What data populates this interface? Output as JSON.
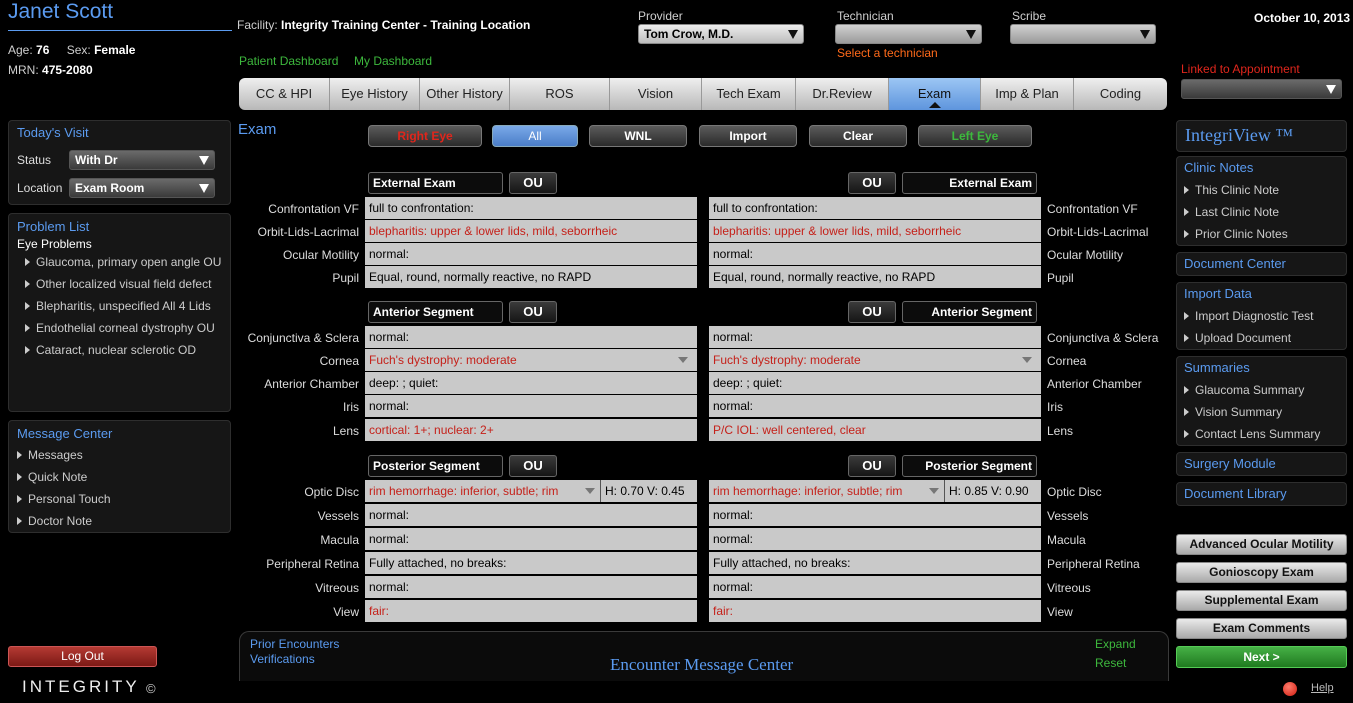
{
  "patient": {
    "name": "Janet Scott",
    "age_label": "Age:",
    "age": "76",
    "sex_label": "Sex:",
    "sex": "Female",
    "mrn_label": "MRN:",
    "mrn": "475-2080"
  },
  "header": {
    "facility_label": "Facility:",
    "facility": "Integrity Training Center - Training Location",
    "patient_dashboard": "Patient Dashboard",
    "my_dashboard": "My Dashboard",
    "provider_label": "Provider",
    "provider": "Tom Crow, M.D.",
    "technician_label": "Technician",
    "technician": "",
    "technician_hint": "Select a technician",
    "scribe_label": "Scribe",
    "scribe": "",
    "date": "October 10, 2013",
    "linked_label": "Linked to Appointment",
    "linked": ""
  },
  "tabs": [
    "CC & HPI",
    "Eye History",
    "Other History",
    "ROS",
    "Vision",
    "Tech Exam",
    "Dr.Review",
    "Exam",
    "Imp & Plan",
    "Coding"
  ],
  "todays_visit": {
    "title": "Today's Visit",
    "status_label": "Status",
    "status": "With Dr",
    "location_label": "Location",
    "location": "Exam Room"
  },
  "problem_list": {
    "title": "Problem List",
    "subtitle": "Eye Problems",
    "items": [
      "Glaucoma, primary open angle OU",
      "Other localized visual field defect",
      "Blepharitis, unspecified All 4 Lids",
      "Endothelial corneal dystrophy OU",
      "Cataract, nuclear sclerotic OD"
    ]
  },
  "message_center": {
    "title": "Message Center",
    "items": [
      "Messages",
      "Quick Note",
      "Personal Touch",
      "Doctor Note"
    ]
  },
  "logout": "Log Out",
  "logo": "INTEGRITY",
  "exam": {
    "title": "Exam",
    "buttons": {
      "right_eye": "Right Eye",
      "all": "All",
      "wnl": "WNL",
      "import": "Import",
      "clear": "Clear",
      "left_eye": "Left Eye"
    },
    "ou": "OU",
    "sections": [
      {
        "name": "External Exam",
        "rows": [
          {
            "label": "Confrontation VF",
            "od": "full to confrontation:",
            "os": "full to confrontation:",
            "red": false
          },
          {
            "label": "Orbit-Lids-Lacrimal",
            "od": "blepharitis: upper & lower lids, mild, seborrheic",
            "os": "blepharitis: upper & lower lids, mild, seborrheic",
            "red": true
          },
          {
            "label": "Ocular Motility",
            "od": "normal:",
            "os": "normal:",
            "red": false
          },
          {
            "label": "Pupil",
            "od": "Equal, round, normally reactive, no RAPD",
            "os": "Equal, round, normally reactive, no RAPD",
            "red": false
          }
        ]
      },
      {
        "name": "Anterior Segment",
        "rows": [
          {
            "label": "Conjunctiva & Sclera",
            "od": "normal:",
            "os": "normal:",
            "red": false
          },
          {
            "label": "Cornea",
            "od": "Fuch's dystrophy: moderate",
            "os": "Fuch's dystrophy: moderate",
            "red": true
          },
          {
            "label": "Anterior Chamber",
            "od": "deep: ; quiet:",
            "os": "deep: ; quiet:",
            "red": false
          },
          {
            "label": "Iris",
            "od": "normal:",
            "os": "normal:",
            "red": false
          },
          {
            "label": "Lens",
            "od": "cortical: 1+; nuclear: 2+",
            "os": "P/C IOL: well centered, clear",
            "red": true
          }
        ]
      },
      {
        "name": "Posterior Segment",
        "rows": [
          {
            "label": "Optic Disc",
            "od": "rim hemorrhage: inferior, subtle; rim",
            "os": "rim hemorrhage: inferior, subtle; rim",
            "red": true,
            "od_hv": "H: 0.70 V: 0.45",
            "os_hv": "H: 0.85 V: 0.90"
          },
          {
            "label": "Vessels",
            "od": "normal:",
            "os": "normal:",
            "red": false
          },
          {
            "label": "Macula",
            "od": "normal:",
            "os": "normal:",
            "red": false
          },
          {
            "label": "Peripheral Retina",
            "od": "Fully attached, no breaks:",
            "os": "Fully attached, no breaks:",
            "red": false
          },
          {
            "label": "Vitreous",
            "od": "normal:",
            "os": "normal:",
            "red": false
          },
          {
            "label": "View",
            "od": "fair:",
            "os": "fair:",
            "red": true
          }
        ]
      }
    ]
  },
  "encounter": {
    "prior": "Prior Encounters",
    "verifications": "Verifications",
    "title": "Encounter Message Center",
    "expand": "Expand",
    "reset": "Reset"
  },
  "integriview": {
    "title": "IntegriView ™",
    "clinic_notes": {
      "title": "Clinic Notes",
      "items": [
        "This Clinic Note",
        "Last Clinic Note",
        "Prior Clinic Notes"
      ]
    },
    "document_center": "Document Center",
    "import_data": {
      "title": "Import Data",
      "items": [
        "Import Diagnostic Test",
        "Upload Document"
      ]
    },
    "summaries": {
      "title": "Summaries",
      "items": [
        "Glaucoma Summary",
        "Vision Summary",
        "Contact Lens Summary"
      ]
    },
    "surgery": "Surgery Module",
    "library": "Document Library"
  },
  "right_buttons": [
    "Advanced Ocular Motility",
    "Gonioscopy Exam",
    "Supplemental Exam",
    "Exam Comments"
  ],
  "next": "Next >",
  "help": "Help",
  "colors": {
    "accent_blue": "#5b9bf0",
    "link_green": "#3db83d",
    "alert_red": "#e0261c",
    "hint_orange": "#ff6a1a"
  }
}
